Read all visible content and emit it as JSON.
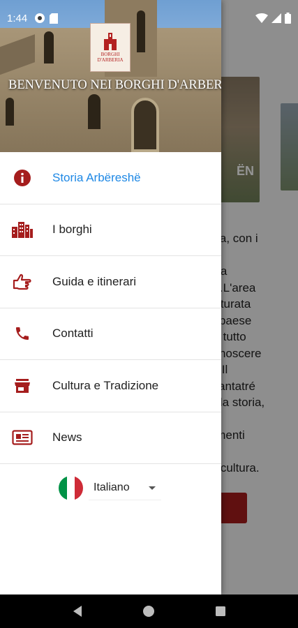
{
  "status_bar": {
    "time": "1:44"
  },
  "background": {
    "card_text": "ËN",
    "body_text": "oria, con i\ndi\nerta\nhë.L'area\nrutturata\nlo paese\nire tutto\nconoscere\nali.Il\nssantatré\na, la storia,\n\ndimenti\nto,\nro cultura."
  },
  "drawer": {
    "header": {
      "title": "BENVENUTO NEI BORGHI D'ARBERIA",
      "logo_text": [
        "BORGHI",
        "D'ARBERIA"
      ]
    },
    "items": [
      {
        "label": "Storia Arbëreshë",
        "icon": "info-icon",
        "active": true
      },
      {
        "label": "I borghi",
        "icon": "city-icon",
        "active": false
      },
      {
        "label": "Guida e itinerari",
        "icon": "hand-pointer-icon",
        "active": false
      },
      {
        "label": "Contatti",
        "icon": "phone-icon",
        "active": false
      },
      {
        "label": "Cultura e Tradizione",
        "icon": "store-icon",
        "active": false
      },
      {
        "label": "News",
        "icon": "newspaper-icon",
        "active": false
      }
    ],
    "language": {
      "selected": "Italiano",
      "flag": "italy-flag-icon"
    }
  },
  "colors": {
    "accent": "#1e88e5",
    "icon": "#a51d1d",
    "label": "#212121"
  }
}
